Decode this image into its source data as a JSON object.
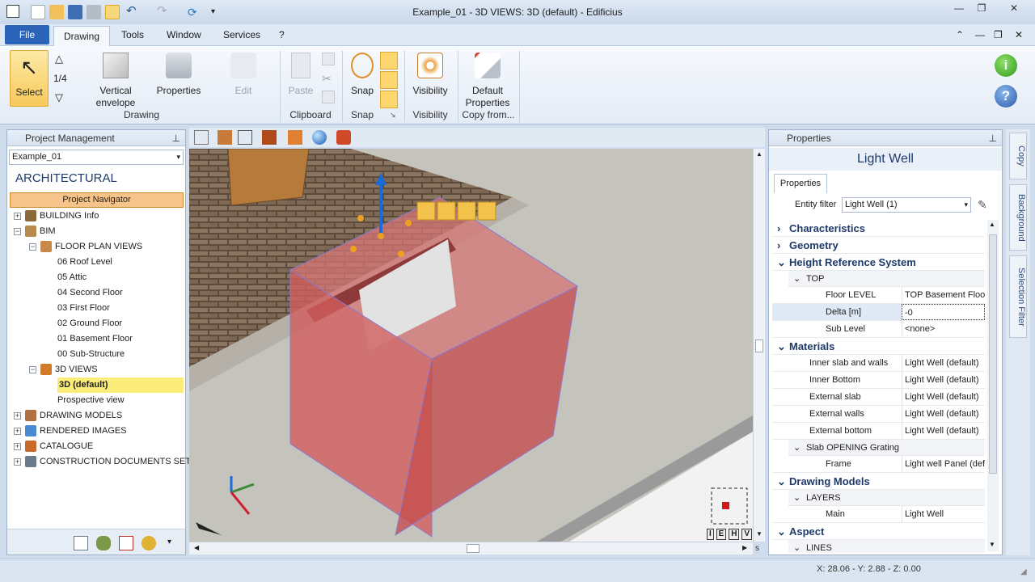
{
  "window": {
    "title": "Example_01 - 3D VIEWS: 3D (default) - Edificius"
  },
  "menu": {
    "file": "File",
    "tabs": [
      "Drawing",
      "Tools",
      "Window",
      "Services",
      "?"
    ]
  },
  "ribbon": {
    "select": "Select",
    "fraction": "1/4",
    "vertical_envelope_1": "Vertical",
    "vertical_envelope_2": "envelope",
    "properties": "Properties",
    "edit": "Edit",
    "group_drawing": "Drawing",
    "paste": "Paste",
    "group_clipboard": "Clipboard",
    "snap": "Snap",
    "group_snap": "Snap",
    "visibility": "Visibility",
    "group_visibility": "Visibility",
    "default_properties_1": "Default",
    "default_properties_2": "Properties",
    "group_copy_from": "Copy from..."
  },
  "left_panel": {
    "title": "Project Management",
    "project_select": "Example_01",
    "section": "ARCHITECTURAL",
    "navigator": "Project Navigator",
    "tree": [
      {
        "label": "BUILDING Info",
        "level": 0,
        "exp": "+",
        "color": "#8a6a3a"
      },
      {
        "label": "BIM",
        "level": 0,
        "exp": "−",
        "color": "#b58a4a"
      },
      {
        "label": "FLOOR PLAN VIEWS",
        "level": 1,
        "exp": "−",
        "color": "#c8884a"
      },
      {
        "label": "06 Roof Level",
        "level": 2,
        "exp": "",
        "color": ""
      },
      {
        "label": "05 Attic",
        "level": 2,
        "exp": "",
        "color": ""
      },
      {
        "label": "04 Second Floor",
        "level": 2,
        "exp": "",
        "color": ""
      },
      {
        "label": "03 First Floor",
        "level": 2,
        "exp": "",
        "color": ""
      },
      {
        "label": "02 Ground Floor",
        "level": 2,
        "exp": "",
        "color": ""
      },
      {
        "label": "01 Basement Floor",
        "level": 2,
        "exp": "",
        "color": ""
      },
      {
        "label": "00 Sub-Structure",
        "level": 2,
        "exp": "",
        "color": ""
      },
      {
        "label": "3D VIEWS",
        "level": 1,
        "exp": "−",
        "color": "#d07a2a"
      },
      {
        "label": "3D (default)",
        "level": 2,
        "exp": "",
        "color": "",
        "selected": true
      },
      {
        "label": "Prospective view",
        "level": 2,
        "exp": "",
        "color": ""
      },
      {
        "label": "DRAWING MODELS",
        "level": 0,
        "exp": "+",
        "color": "#b07040"
      },
      {
        "label": "RENDERED IMAGES",
        "level": 0,
        "exp": "+",
        "color": "#4a8ad0"
      },
      {
        "label": "CATALOGUE",
        "level": 0,
        "exp": "+",
        "color": "#c86a2a"
      },
      {
        "label": "CONSTRUCTION DOCUMENTS SET",
        "level": 0,
        "exp": "+",
        "color": "#6a7a8a"
      }
    ]
  },
  "properties_panel": {
    "title": "Properties",
    "object": "Light Well",
    "tab": "Properties",
    "entity_filter_label": "Entity filter",
    "entity_filter_value": "Light Well (1)",
    "rows": [
      {
        "t": "cat",
        "label": "Characteristics",
        "arrow": "›"
      },
      {
        "t": "cat",
        "label": "Geometry",
        "arrow": "›"
      },
      {
        "t": "cat",
        "label": "Height Reference System",
        "arrow": "⌄"
      },
      {
        "t": "sub",
        "label": "TOP"
      },
      {
        "t": "prop",
        "k": "Floor LEVEL",
        "v": "TOP Basement Floor",
        "indent": 66
      },
      {
        "t": "prop",
        "k": "Delta  [m]",
        "v": "-0",
        "indent": 66,
        "edit": true
      },
      {
        "t": "prop",
        "k": "Sub Level",
        "v": "<none>",
        "indent": 66
      },
      {
        "t": "cat",
        "label": "Materials",
        "arrow": "⌄"
      },
      {
        "t": "prop",
        "k": "Inner slab and walls",
        "v": "Light Well (default)",
        "indent": 46
      },
      {
        "t": "prop",
        "k": "Inner Bottom",
        "v": "Light Well (default)",
        "indent": 46
      },
      {
        "t": "prop",
        "k": "External slab",
        "v": "Light Well (default)",
        "indent": 46
      },
      {
        "t": "prop",
        "k": "External walls",
        "v": "Light Well (default)",
        "indent": 46
      },
      {
        "t": "prop",
        "k": "External bottom",
        "v": "Light Well (default)",
        "indent": 46
      },
      {
        "t": "sub",
        "label": "Slab OPENING Grating"
      },
      {
        "t": "prop",
        "k": "Frame",
        "v": "Light well Panel (defa",
        "indent": 66
      },
      {
        "t": "cat",
        "label": "Drawing Models",
        "arrow": "⌄"
      },
      {
        "t": "sub",
        "label": "LAYERS"
      },
      {
        "t": "prop",
        "k": "Main",
        "v": "Light Well",
        "indent": 66
      },
      {
        "t": "cat",
        "label": "Aspect",
        "arrow": "⌄"
      },
      {
        "t": "sub",
        "label": "LINES"
      }
    ]
  },
  "side_tabs": [
    "Copy",
    "Background",
    "Selection Filter"
  ],
  "viewport": {
    "view_cube": [
      "I",
      "E",
      "H",
      "V"
    ],
    "scroll_label": "s"
  },
  "status": {
    "coords": "X: 28.06 - Y: 2.88 - Z: 0.00"
  }
}
